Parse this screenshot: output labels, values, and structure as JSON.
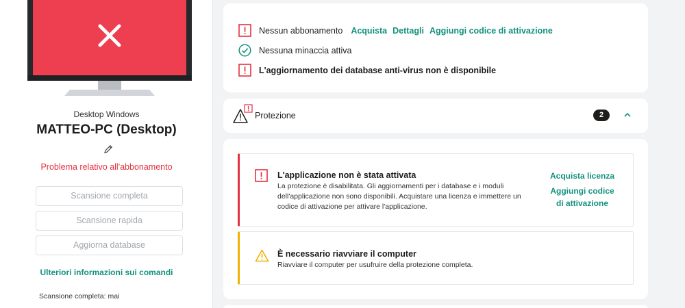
{
  "device": {
    "type": "Desktop Windows",
    "name": "MATTEO-PC (Desktop)",
    "problem": "Problema relativo all'abbonamento"
  },
  "commands": {
    "full_scan": "Scansione completa",
    "quick_scan": "Scansione rapida",
    "update_db": "Aggiorna database",
    "more_info": "Ulteriori informazioni sui comandi"
  },
  "last_scan": {
    "label": "Scansione completa:",
    "value": "mai"
  },
  "status": {
    "subscription": "Nessun abbonamento",
    "buy": "Acquista",
    "details": "Dettagli",
    "add_code": "Aggiungi codice di attivazione",
    "threats": "Nessuna minaccia attiva",
    "db_update": "L'aggiornamento dei database anti-virus non è disponibile"
  },
  "protection": {
    "title": "Protezione",
    "count": "2"
  },
  "issues": [
    {
      "title": "L'applicazione non è stata attivata",
      "desc_lines": [
        "La protezione è disabilitata. Gli aggiornamenti per i database e i moduli",
        "dell'applicazione non sono disponibili. Acquistare una licenza e immettere un",
        "codice di attivazione per attivare l'applicazione."
      ],
      "action1": "Acquista licenza",
      "action2_line1": "Aggiungi codice",
      "action2_line2": "di attivazione"
    },
    {
      "title": "È necessario riavviare il computer",
      "desc_lines": [
        "Riavviare il computer per usufruire della protezione completa."
      ]
    }
  ],
  "icons": {
    "monitor": "monitor-icon",
    "error_cross": "close-icon",
    "edit": "pencil-icon",
    "warning": "exclamation-square-icon",
    "ok": "check-circle-icon",
    "alert": "warning-triangle-icon",
    "chevron": "chevron-up-icon"
  },
  "colors": {
    "accent": "#13927f",
    "danger": "#e4303f",
    "warning": "#f0b100"
  }
}
